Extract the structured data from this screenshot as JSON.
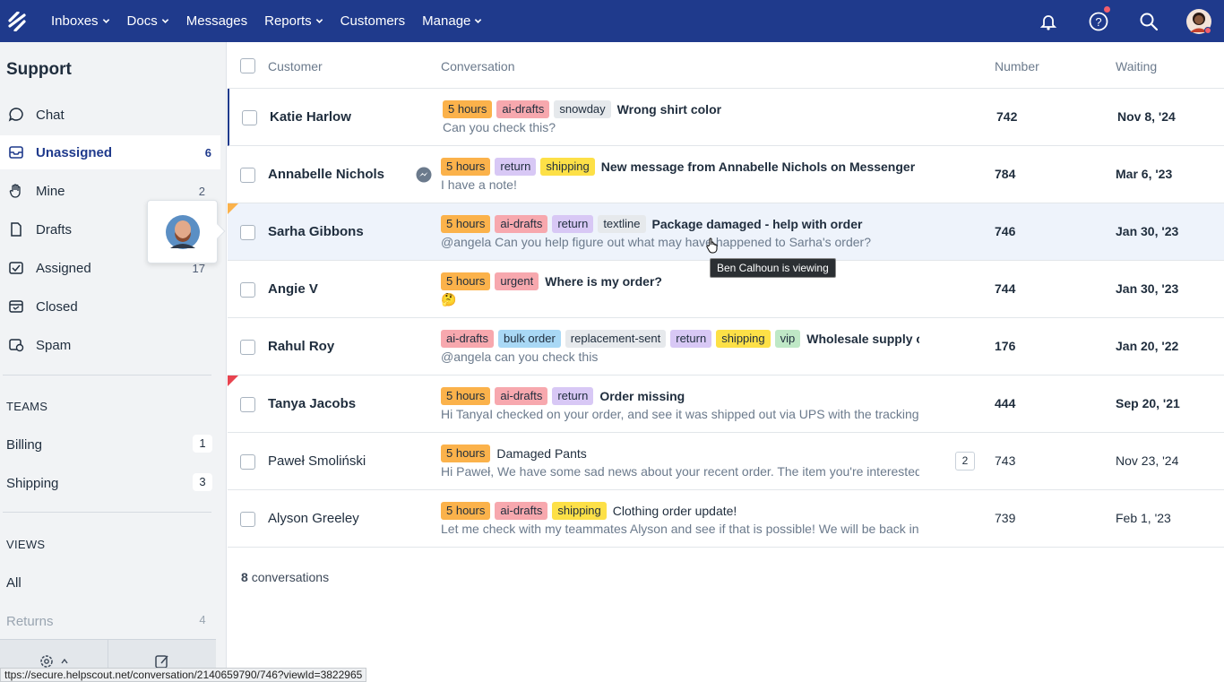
{
  "nav": {
    "items": [
      {
        "label": "Inboxes",
        "dropdown": true
      },
      {
        "label": "Docs",
        "dropdown": true
      },
      {
        "label": "Messages",
        "dropdown": false
      },
      {
        "label": "Reports",
        "dropdown": true
      },
      {
        "label": "Customers",
        "dropdown": false
      },
      {
        "label": "Manage",
        "dropdown": true
      }
    ],
    "icons": [
      "bell-icon",
      "help-icon",
      "search-icon",
      "avatar"
    ]
  },
  "sidebar": {
    "title": "Support",
    "folders": [
      {
        "label": "Chat",
        "count": "",
        "icon": "chat-icon"
      },
      {
        "label": "Unassigned",
        "count": "6",
        "icon": "inbox-icon",
        "active": true
      },
      {
        "label": "Mine",
        "count": "2",
        "icon": "hand-icon"
      },
      {
        "label": "Drafts",
        "count": "",
        "icon": "draft-icon"
      },
      {
        "label": "Assigned",
        "count": "17",
        "icon": "assigned-icon"
      },
      {
        "label": "Closed",
        "count": "",
        "icon": "closed-icon"
      },
      {
        "label": "Spam",
        "count": "",
        "icon": "spam-icon"
      }
    ],
    "teams_heading": "TEAMS",
    "teams": [
      {
        "label": "Billing",
        "count": "1"
      },
      {
        "label": "Shipping",
        "count": "3"
      }
    ],
    "views_heading": "VIEWS",
    "views": [
      {
        "label": "All",
        "count": ""
      },
      {
        "label": "Returns",
        "count": "4"
      }
    ]
  },
  "table": {
    "headers": {
      "customer": "Customer",
      "conversation": "Conversation",
      "number": "Number",
      "waiting": "Waiting"
    },
    "rows": [
      {
        "customer": "Katie Harlow",
        "tags": [
          "5 hours",
          "ai-drafts",
          "snowday"
        ],
        "subject": "Wrong shirt color",
        "preview": "Can you check this?",
        "number": "742",
        "waiting": "Nov 8, '24",
        "unread": true
      },
      {
        "customer": "Annabelle Nichols",
        "tags": [
          "5 hours",
          "return",
          "shipping"
        ],
        "subject": "New message from Annabelle Nichols on Messenger",
        "preview": "I have a note!",
        "number": "784",
        "waiting": "Mar 6, '23",
        "unread": true
      },
      {
        "customer": "Sarha Gibbons",
        "tags": [
          "5 hours",
          "ai-drafts",
          "return",
          "textline"
        ],
        "subject": "Package damaged - help with order",
        "preview": "@angela Can you help figure out what may have happened to Sarha's order?",
        "number": "746",
        "waiting": "Jan 30, '23",
        "unread": true
      },
      {
        "customer": "Angie V",
        "tags": [
          "5 hours",
          "urgent"
        ],
        "subject": "Where is my order?",
        "preview": "🤔",
        "number": "744",
        "waiting": "Jan 30, '23",
        "unread": true
      },
      {
        "customer": "Rahul Roy",
        "tags": [
          "ai-drafts",
          "bulk order",
          "replacement-sent",
          "return",
          "shipping",
          "vip"
        ],
        "subject": "Wholesale supply order",
        "preview": "@angela can you check this",
        "number": "176",
        "waiting": "Jan 20, '22",
        "unread": true
      },
      {
        "customer": "Tanya Jacobs",
        "tags": [
          "5 hours",
          "ai-drafts",
          "return"
        ],
        "subject": "Order missing",
        "preview": "Hi TanyaI checked on your order, and see it was shipped out via UPS with the tracking number",
        "number": "444",
        "waiting": "Sep 20, '21",
        "unread": true
      },
      {
        "customer": "Paweł Smoliński",
        "tags": [
          "5 hours"
        ],
        "subject": "Damaged Pants",
        "preview": "Hi Paweł, We have some sad news about your recent order. The item you're interested in",
        "number": "743",
        "waiting": "Nov 23, '24",
        "unread": false,
        "thread_count": "2"
      },
      {
        "customer": "Alyson Greeley",
        "tags": [
          "5 hours",
          "ai-drafts",
          "shipping"
        ],
        "subject": "Clothing order update!",
        "preview": "Let me check with my teammates Alyson and see if that is possible! We will be back in touch",
        "number": "739",
        "waiting": "Feb 1, '23",
        "unread": false
      }
    ]
  },
  "tag_colors": {
    "5 hours": "#fbb24b",
    "ai-drafts": "#f7a8ae",
    "snowday": "#e6e9ec",
    "return": "#d8c8f5",
    "shipping": "#fde047",
    "textline": "#e6e9ec",
    "urgent": "#f7a8ae",
    "bulk order": "#a9d8f5",
    "replacement-sent": "#e6e9ec",
    "vip": "#bfe8c6"
  },
  "tooltip": "Ben Calhoun is viewing",
  "footer": {
    "count": "8",
    "label": "conversations"
  },
  "status_url": "ttps://secure.helpscout.net/conversation/2140659790/746?viewId=3822965",
  "colors": {
    "nav_bg": "#1f3a8c",
    "accent": "#1f3a8c"
  }
}
